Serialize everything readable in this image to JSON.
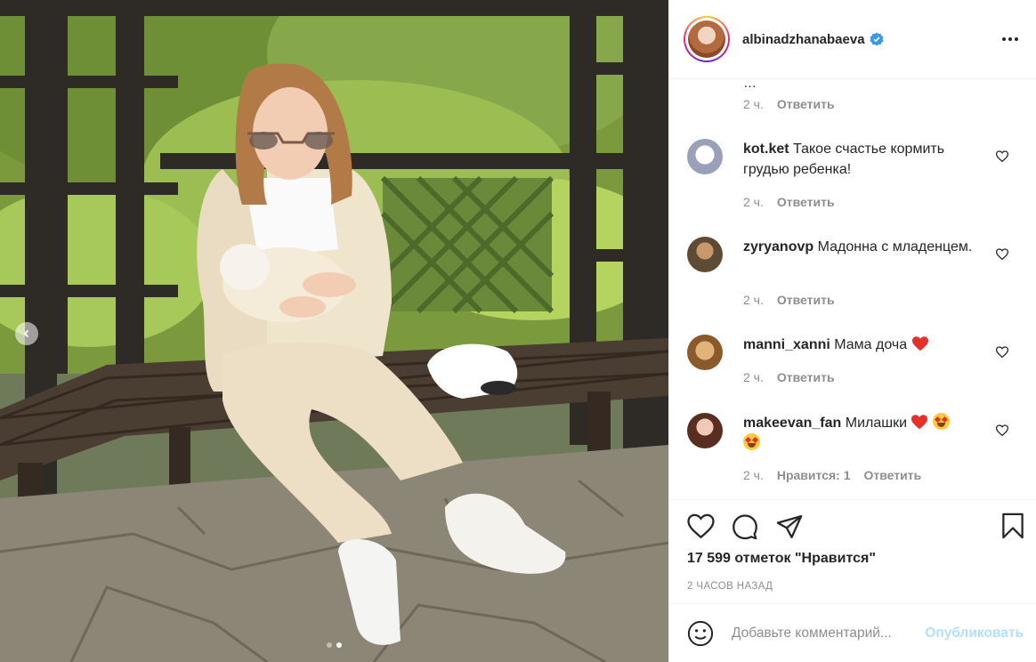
{
  "post": {
    "author": {
      "username": "albinadzhanabaeva",
      "verified": true
    },
    "photo": {
      "slides_total": 2,
      "active_slide": 2
    },
    "comments_cut": {
      "text": "…",
      "time": "2 ч.",
      "reply": "Ответить"
    },
    "comments": [
      {
        "user": "kot.ket",
        "text": "Такое счастье кормить грудью ребенка!",
        "time": "2 ч.",
        "reply": "Ответить",
        "likes": ""
      },
      {
        "user": "zyryanovp",
        "text": "Мадонна с младенцем.",
        "time": "2 ч.",
        "reply": "Ответить",
        "likes": ""
      },
      {
        "user": "manni_xanni",
        "text": "Мама доча",
        "time": "2 ч.",
        "reply": "Ответить",
        "likes": ""
      },
      {
        "user": "makeevan_fan",
        "text": "Милашки",
        "time": "2 ч.",
        "reply": "Ответить",
        "likes": "Нравится: 1"
      }
    ],
    "likes_text": "17 599 отметок \"Нравится\"",
    "timestamp": "2 ЧАСОВ НАЗАД",
    "add_comment": {
      "placeholder": "Добавьте комментарий...",
      "publish": "Опубликовать"
    },
    "icons": [
      "like-icon",
      "comment-icon",
      "share-icon",
      "save-icon",
      "more-options-icon",
      "emoji-icon",
      "verified-icon",
      "carousel-prev-icon"
    ],
    "colors": {
      "verified": "#3897f0",
      "publish_disabled": "#b2dffc",
      "heart_red": "#e3312b",
      "muted": "#8e8e8e"
    }
  }
}
